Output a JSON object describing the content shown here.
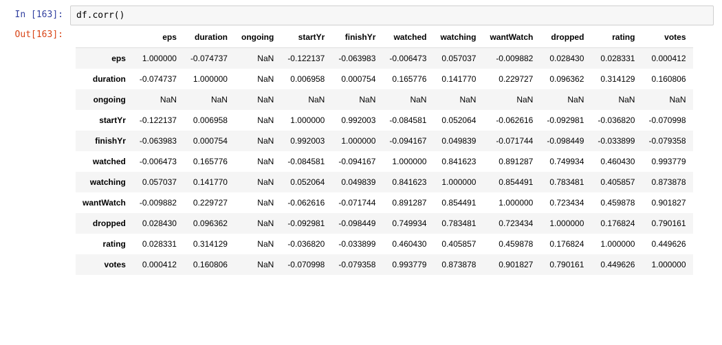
{
  "prompt_in": "In [163]:",
  "prompt_out": "Out[163]:",
  "code": "df.corr()",
  "table": {
    "columns": [
      "eps",
      "duration",
      "ongoing",
      "startYr",
      "finishYr",
      "watched",
      "watching",
      "wantWatch",
      "dropped",
      "rating",
      "votes"
    ],
    "index": [
      "eps",
      "duration",
      "ongoing",
      "startYr",
      "finishYr",
      "watched",
      "watching",
      "wantWatch",
      "dropped",
      "rating",
      "votes"
    ],
    "rows": [
      [
        "1.000000",
        "-0.074737",
        "NaN",
        "-0.122137",
        "-0.063983",
        "-0.006473",
        "0.057037",
        "-0.009882",
        "0.028430",
        "0.028331",
        "0.000412"
      ],
      [
        "-0.074737",
        "1.000000",
        "NaN",
        "0.006958",
        "0.000754",
        "0.165776",
        "0.141770",
        "0.229727",
        "0.096362",
        "0.314129",
        "0.160806"
      ],
      [
        "NaN",
        "NaN",
        "NaN",
        "NaN",
        "NaN",
        "NaN",
        "NaN",
        "NaN",
        "NaN",
        "NaN",
        "NaN"
      ],
      [
        "-0.122137",
        "0.006958",
        "NaN",
        "1.000000",
        "0.992003",
        "-0.084581",
        "0.052064",
        "-0.062616",
        "-0.092981",
        "-0.036820",
        "-0.070998"
      ],
      [
        "-0.063983",
        "0.000754",
        "NaN",
        "0.992003",
        "1.000000",
        "-0.094167",
        "0.049839",
        "-0.071744",
        "-0.098449",
        "-0.033899",
        "-0.079358"
      ],
      [
        "-0.006473",
        "0.165776",
        "NaN",
        "-0.084581",
        "-0.094167",
        "1.000000",
        "0.841623",
        "0.891287",
        "0.749934",
        "0.460430",
        "0.993779"
      ],
      [
        "0.057037",
        "0.141770",
        "NaN",
        "0.052064",
        "0.049839",
        "0.841623",
        "1.000000",
        "0.854491",
        "0.783481",
        "0.405857",
        "0.873878"
      ],
      [
        "-0.009882",
        "0.229727",
        "NaN",
        "-0.062616",
        "-0.071744",
        "0.891287",
        "0.854491",
        "1.000000",
        "0.723434",
        "0.459878",
        "0.901827"
      ],
      [
        "0.028430",
        "0.096362",
        "NaN",
        "-0.092981",
        "-0.098449",
        "0.749934",
        "0.783481",
        "0.723434",
        "1.000000",
        "0.176824",
        "0.790161"
      ],
      [
        "0.028331",
        "0.314129",
        "NaN",
        "-0.036820",
        "-0.033899",
        "0.460430",
        "0.405857",
        "0.459878",
        "0.176824",
        "1.000000",
        "0.449626"
      ],
      [
        "0.000412",
        "0.160806",
        "NaN",
        "-0.070998",
        "-0.079358",
        "0.993779",
        "0.873878",
        "0.901827",
        "0.790161",
        "0.449626",
        "1.000000"
      ]
    ]
  }
}
